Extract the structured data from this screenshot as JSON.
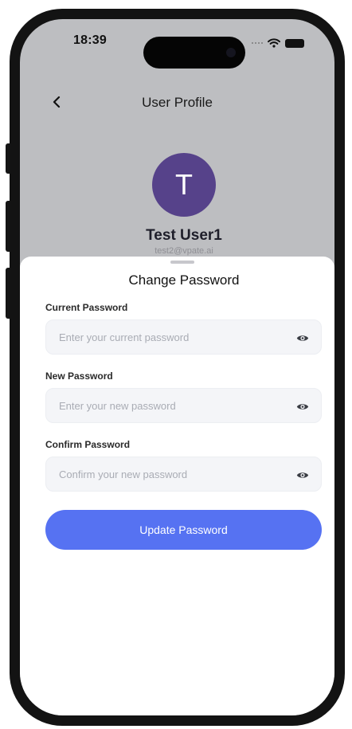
{
  "status_bar": {
    "time": "18:39"
  },
  "header": {
    "title": "User Profile",
    "back_icon": "chevron-left-icon"
  },
  "profile": {
    "avatar_initial": "T",
    "name": "Test User1",
    "email": "test2@vpate.ai",
    "avatar_color": "#56428a"
  },
  "sheet": {
    "title": "Change Password",
    "fields": [
      {
        "label": "Current Password",
        "placeholder": "Enter your current password",
        "value": "",
        "icon": "eye-icon"
      },
      {
        "label": "New Password",
        "placeholder": "Enter your new password",
        "value": "",
        "icon": "eye-icon"
      },
      {
        "label": "Confirm Password",
        "placeholder": "Confirm your new password",
        "value": "",
        "icon": "eye-icon"
      }
    ],
    "submit_label": "Update Password"
  },
  "colors": {
    "accent": "#5672f2",
    "dimmed_background": "#bdbec1",
    "field_background": "#f4f5f8"
  }
}
